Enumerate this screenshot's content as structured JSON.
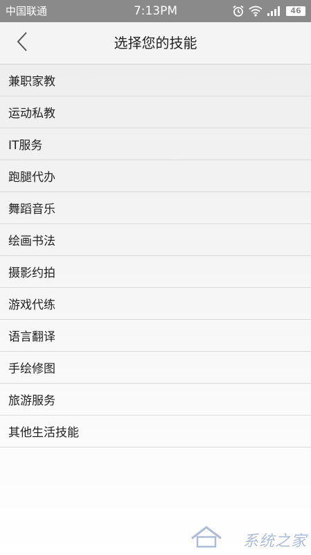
{
  "status_bar": {
    "carrier": "中国联通",
    "time": "7:13PM",
    "battery": "46",
    "icons": [
      "alarm-icon",
      "wifi-icon",
      "signal-icon",
      "battery-icon"
    ]
  },
  "header": {
    "back_icon": "chevron-left-icon",
    "title": "选择您的技能"
  },
  "skills": [
    "兼职家教",
    "运动私教",
    "IT服务",
    "跑腿代办",
    "舞蹈音乐",
    "绘画书法",
    "摄影约拍",
    "游戏代练",
    "语言翻译",
    "手绘修图",
    "旅游服务",
    "其他生活技能"
  ],
  "watermark": {
    "text": "系统之家"
  },
  "colors": {
    "status_bar_bg": "#8a8a8a",
    "header_bg": "#f4f4f4",
    "divider": "#d9d9d9",
    "text": "#222222"
  }
}
